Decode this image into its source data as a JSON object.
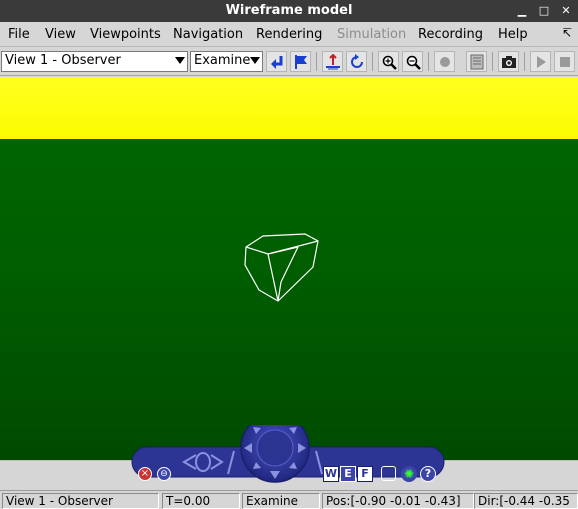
{
  "window": {
    "title": "Wireframe model"
  },
  "menubar": {
    "items": [
      "File",
      "View",
      "Viewpoints",
      "Navigation",
      "Rendering",
      "Simulation",
      "Recording",
      "Help"
    ]
  },
  "toolbar": {
    "viewpoint_select": "View 1 - Observer",
    "mode_select": "Examine"
  },
  "status": {
    "view": "View 1 - Observer",
    "time": "T=0.00",
    "mode": "Examine",
    "position": "Pos:[-0.90 -0.01 -0.43]",
    "direction": "Dir:[-0.44 -0.35"
  },
  "navigator": {
    "walk_label": "W",
    "examine_label": "E",
    "fly_label": "F",
    "help_label": "?"
  },
  "colors": {
    "sky": "#ffff00",
    "ground": "#006600",
    "navigator": "#3a45a8"
  }
}
